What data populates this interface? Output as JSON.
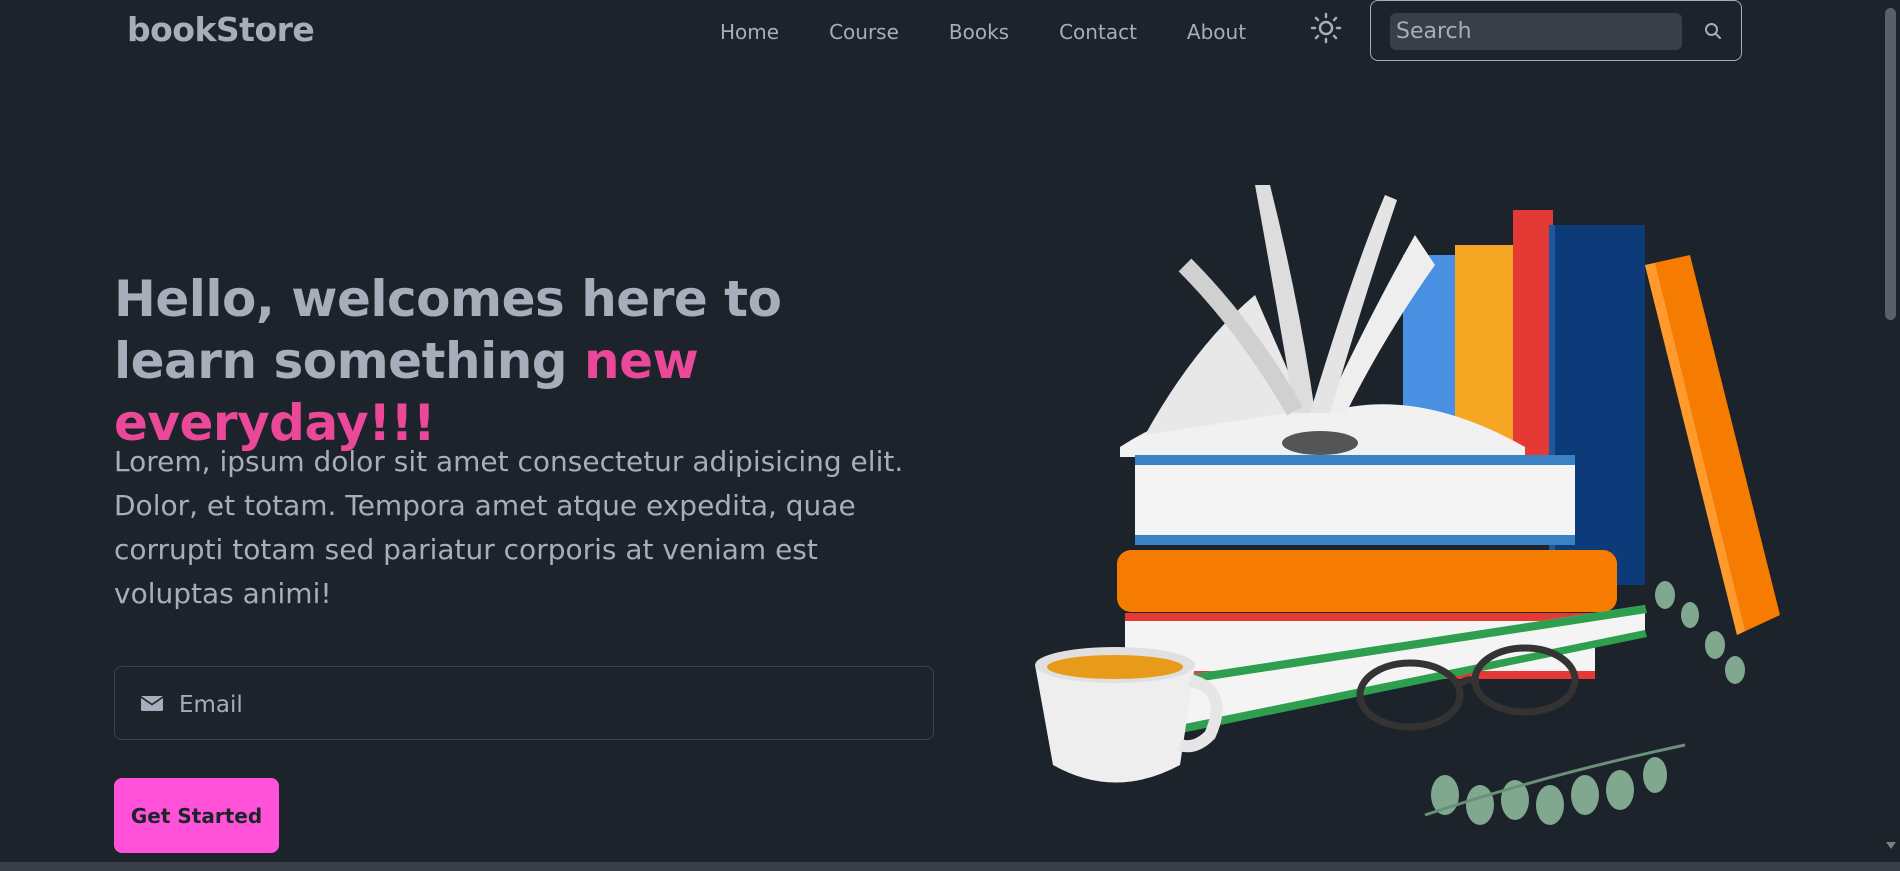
{
  "navbar": {
    "logo": "bookStore",
    "links": [
      {
        "label": "Home"
      },
      {
        "label": "Course"
      },
      {
        "label": "Books"
      },
      {
        "label": "Contact"
      },
      {
        "label": "About"
      }
    ],
    "theme_icon": "sun-icon",
    "search": {
      "placeholder": "Search",
      "icon": "search-icon"
    }
  },
  "hero": {
    "title_main": "Hello, welcomes here to learn something ",
    "title_accent": "new everyday!!!",
    "text": "Lorem, ipsum dolor sit amet consectetur adipisicing elit. Dolor, et totam. Tempora amet atque expedita, quae corrupti totam sed pariatur corporis at veniam est voluptas animi!",
    "email_placeholder": "Email",
    "email_icon": "envelope-icon",
    "cta_label": "Get Started",
    "image": "books-stack-illustration"
  },
  "colors": {
    "background": "#1d232a",
    "text": "#a6adbb",
    "accent": "#ec4899",
    "button": "#ff52d9"
  }
}
